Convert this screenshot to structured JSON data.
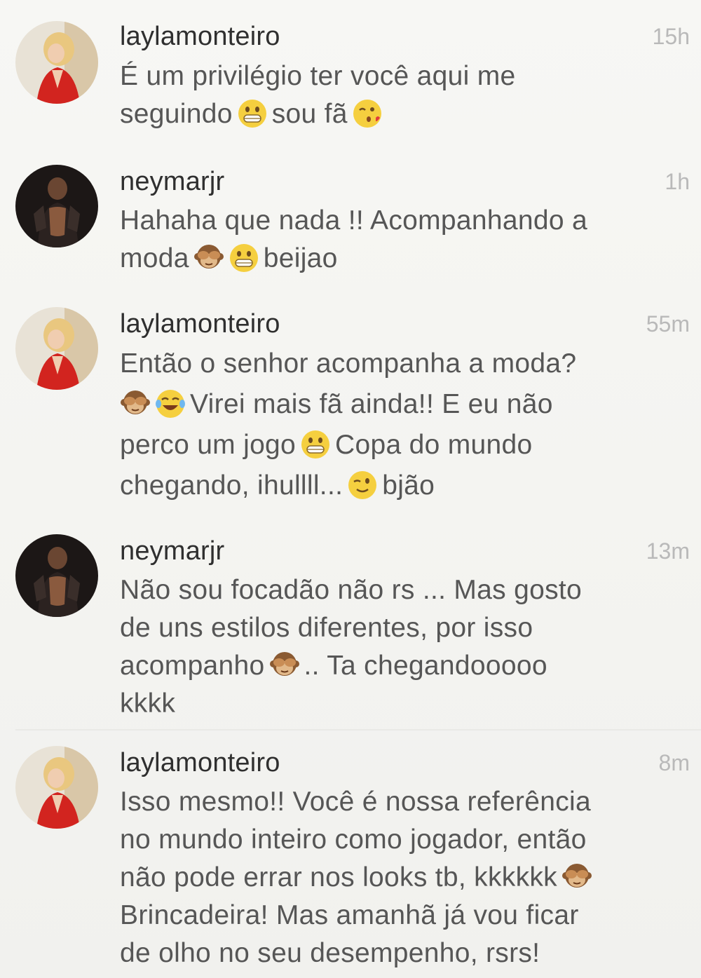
{
  "comments": [
    {
      "username": "laylamonteiro",
      "time": "15h",
      "lines": [
        "É um privilégio ter você aqui me",
        "seguindo",
        "sou fã"
      ]
    },
    {
      "username": "neymarjr",
      "time": "1h",
      "lines": [
        "Hahaha que nada !! Acompanhando a",
        "moda",
        "beijao"
      ]
    },
    {
      "username": "laylamonteiro",
      "time": "55m",
      "lines": [
        "Então o senhor acompanha a moda?",
        "Virei mais fã ainda!! E eu não",
        "perco um jogo",
        "Copa do mundo",
        "chegando, ihullll...",
        "bjão"
      ]
    },
    {
      "username": "neymarjr",
      "time": "13m",
      "lines": [
        "Não sou focadão não rs ... Mas gosto",
        "de uns estilos diferentes, por isso",
        "acompanho",
        ".. Ta chegandooooo",
        "kkkk"
      ]
    },
    {
      "username": "laylamonteiro",
      "time": "8m",
      "lines": [
        "Isso mesmo!! Você é nossa referência",
        "no mundo inteiro como jogador, então",
        "não pode errar nos looks tb, kkkkkk",
        "Brincadeira! Mas amanhã já vou ficar",
        "de olho no seu desempenho, rsrs!"
      ]
    }
  ],
  "icons": {
    "grin": "grinning-face-icon",
    "kiss": "kissing-face-icon",
    "monkey": "see-no-evil-monkey-icon",
    "laugh": "tears-of-joy-icon",
    "wink": "winking-face-icon"
  },
  "colors": {
    "background": "#f4f4f1",
    "username": "#2f2f2f",
    "text": "#565656",
    "time": "#b9b9b9"
  }
}
